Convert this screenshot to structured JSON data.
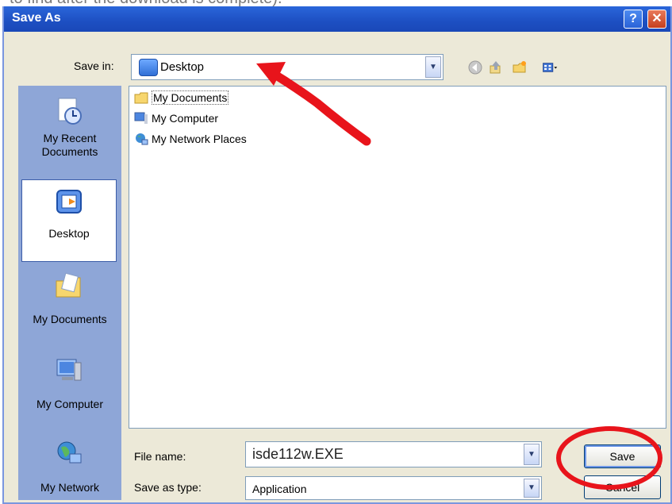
{
  "page_caption": "to find after the download is complete).",
  "window": {
    "title": "Save As",
    "help_label": "?",
    "close_label": "✕"
  },
  "save_in": {
    "label": "Save in:",
    "value": "Desktop"
  },
  "toolbar": {
    "icons": [
      "back-icon",
      "up-folder-icon",
      "new-folder-icon",
      "views-menu-icon"
    ]
  },
  "places": [
    {
      "label": "My Recent Documents",
      "icon": "recent-documents-icon"
    },
    {
      "label": "Desktop",
      "icon": "desktop-icon",
      "selected": true
    },
    {
      "label": "My Documents",
      "icon": "my-documents-icon"
    },
    {
      "label": "My Computer",
      "icon": "my-computer-icon"
    },
    {
      "label": "My Network",
      "icon": "network-places-icon"
    }
  ],
  "files": [
    {
      "label": "My Documents",
      "icon": "folder-icon"
    },
    {
      "label": "My Computer",
      "icon": "computer-icon"
    },
    {
      "label": "My Network Places",
      "icon": "network-icon"
    }
  ],
  "file_name": {
    "label": "File name:",
    "value": "isde112w.EXE"
  },
  "save_as_type": {
    "label": "Save as type:",
    "value": "Application"
  },
  "buttons": {
    "save": "Save",
    "cancel": "Cancel"
  },
  "colors": {
    "annotation": "#e8141b",
    "titlebar": "#2a66da",
    "places_bar": "#8ea6d7"
  }
}
